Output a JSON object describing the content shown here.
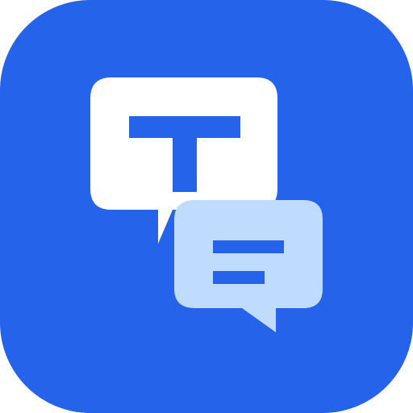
{
  "icon": {
    "name": "chat-translate-app-icon",
    "colors": {
      "background": "#2563EB",
      "primary_bubble": "#FFFFFF",
      "secondary_bubble": "#BFDBFE",
      "glyph": "#2563EB"
    }
  }
}
